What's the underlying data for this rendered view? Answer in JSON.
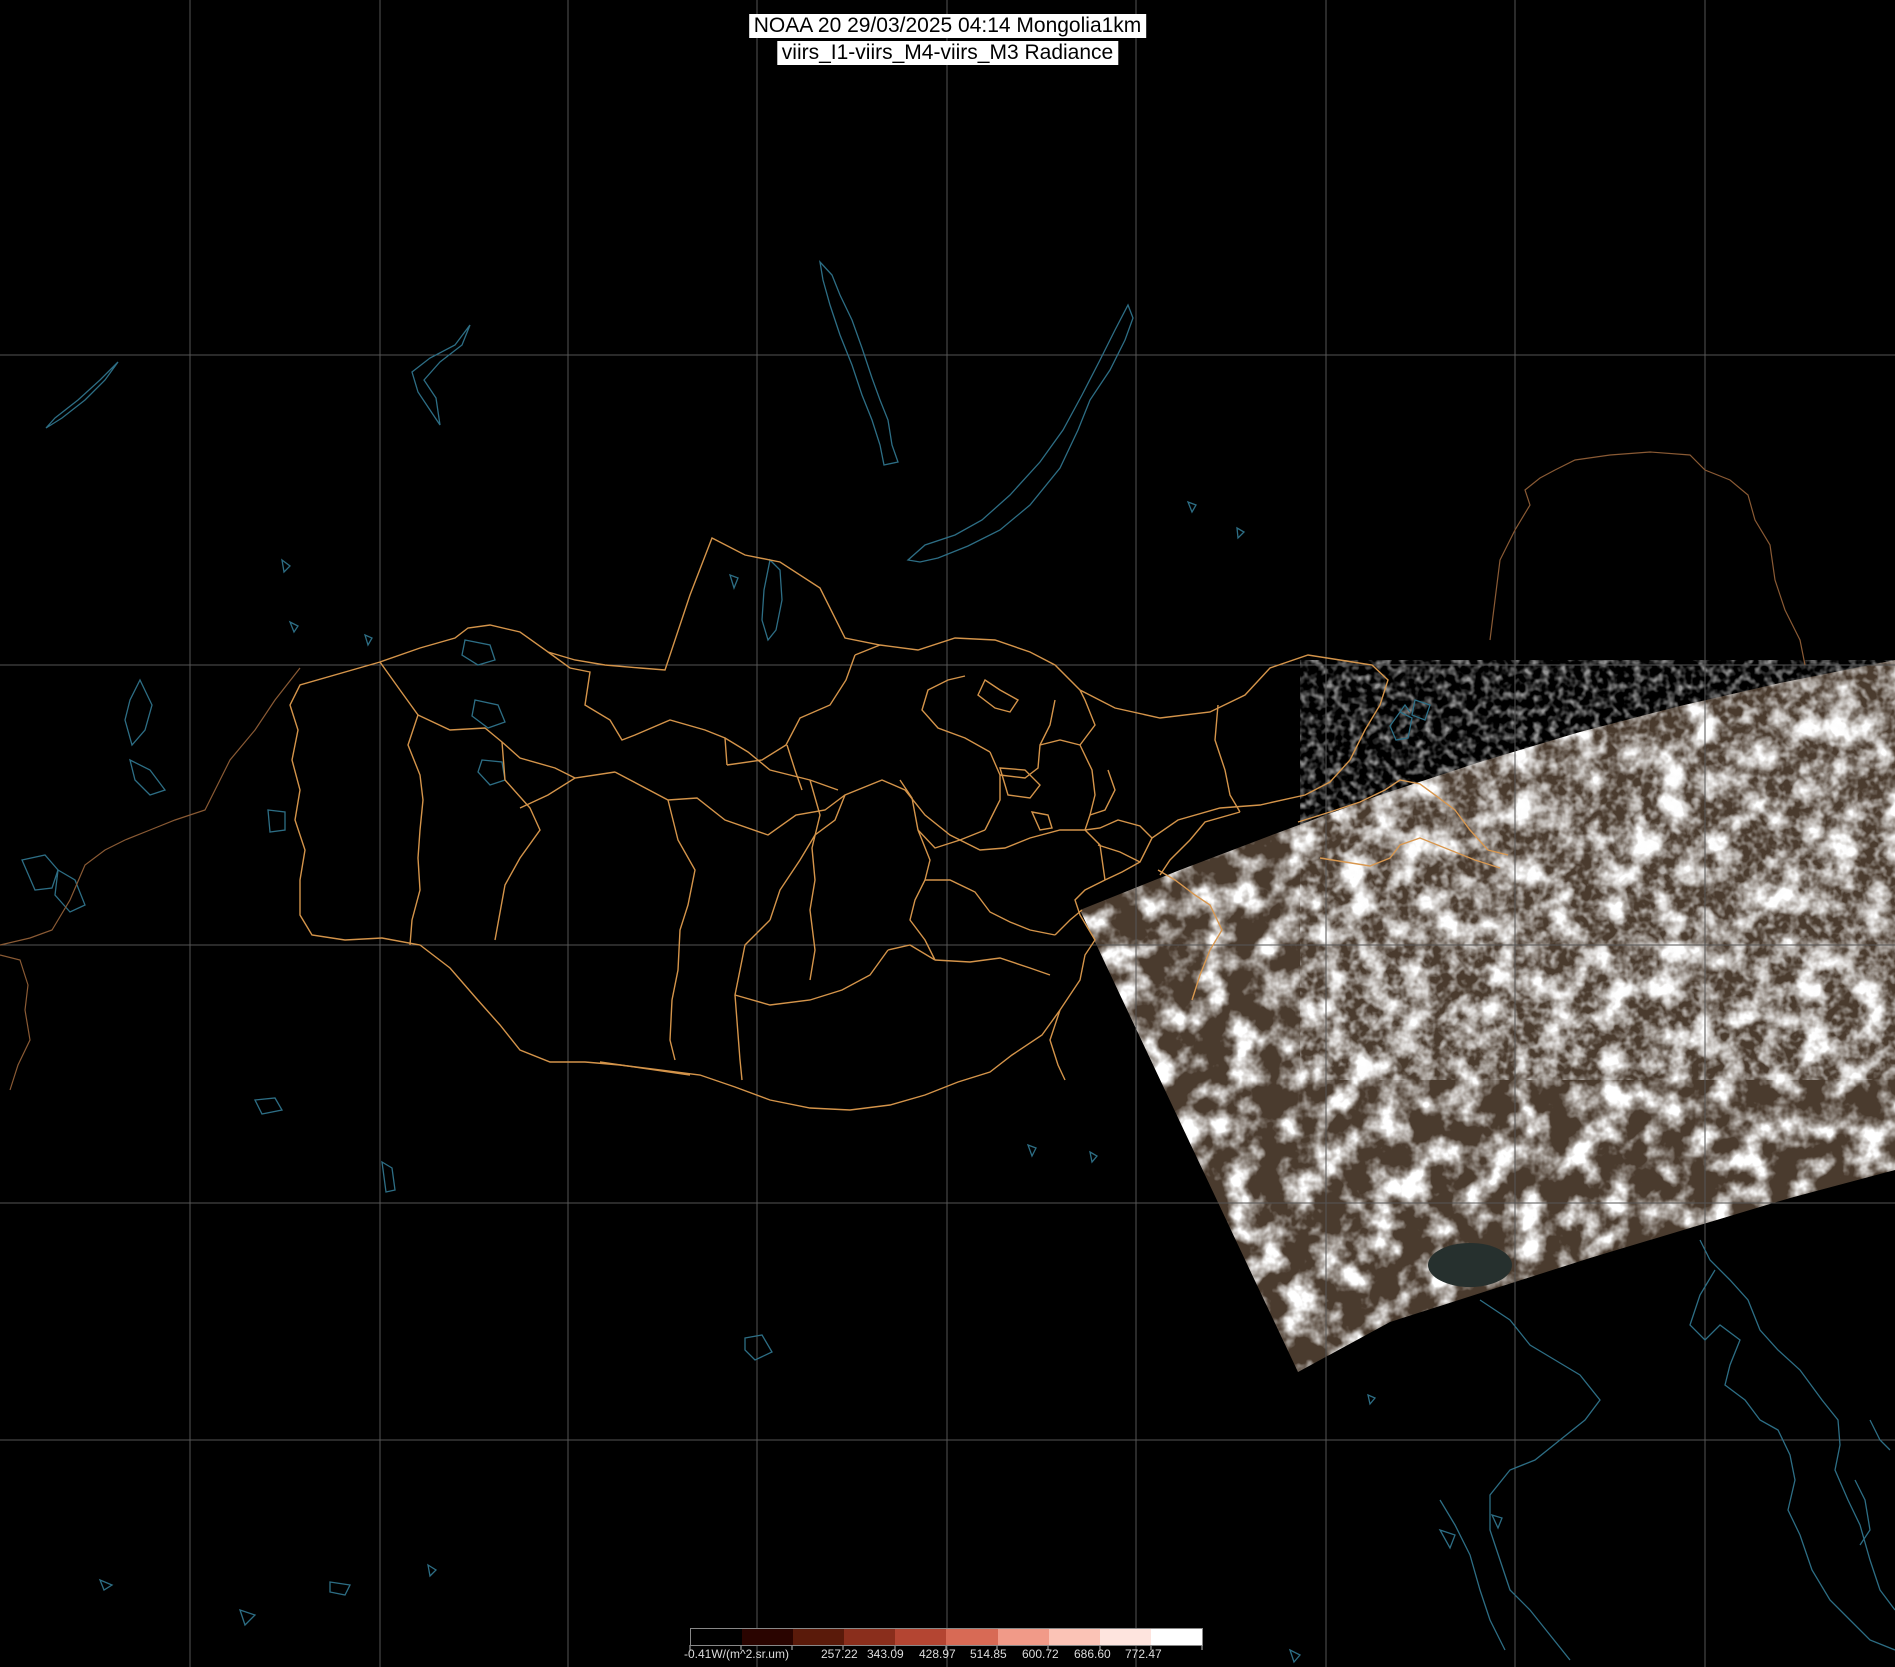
{
  "title": {
    "line1": "NOAA 20 29/03/2025 04:14 Mongolia1km",
    "line2": "viirs_I1-viirs_M4-viirs_M3 Radiance"
  },
  "colorbar": {
    "labels": [
      "-0.41W/(m^2.sr.um)",
      "257.22",
      "343.09",
      "428.97",
      "514.85",
      "600.72",
      "686.60",
      "772.47"
    ],
    "colors": [
      "#000000",
      "#2a0400",
      "#5a1a0a",
      "#8a2e1c",
      "#b44532",
      "#d86a55",
      "#f19a88",
      "#fbc3b6",
      "#fee4de",
      "#ffffff"
    ]
  },
  "colors": {
    "background": "#000000",
    "graticule": "#555555",
    "province_border": "#d4944a",
    "coastline": "#2d6e85",
    "cloud": "#f2f2f2",
    "land": "#4a3b2e"
  }
}
